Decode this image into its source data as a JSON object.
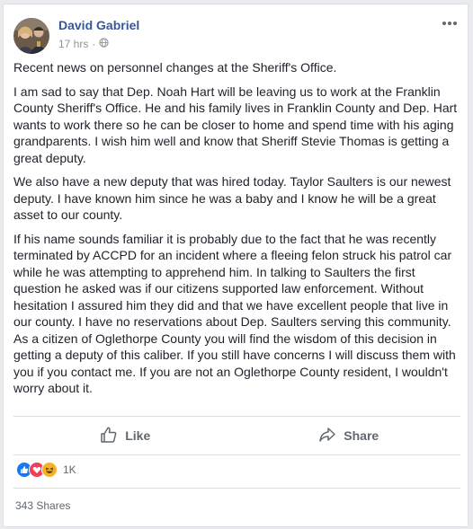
{
  "post": {
    "author": "David Gabriel",
    "time": "17 hrs",
    "separator": "·",
    "paragraphs": [
      "Recent news on personnel changes at the Sheriff's Office.",
      "I am sad to say that Dep. Noah Hart will be leaving us to work at the Franklin County Sheriff's Office. He and his family lives in Franklin County and Dep. Hart wants to work there so he can be closer to home and spend time with his aging grandparents. I wish him well and know that Sheriff Stevie Thomas is getting a great deputy.",
      "We also have a new deputy that was hired today. Taylor Saulters is our newest deputy. I have known him since he was a baby and I know he will be a great asset to our county.",
      "If his name sounds familiar it is probably due to the fact that he was recently terminated by ACCPD for an incident where a fleeing felon struck his patrol car while he was attempting to apprehend him. In talking to Saulters the first question he asked was if our citizens supported law enforcement. Without hesitation I assured him they did and that we have excellent people that live in our county. I have no reservations about Dep. Saulters serving this community. As a citizen of Oglethorpe County you will find the wisdom of this decision in getting a deputy of this caliber. If you still have concerns I will discuss them with you if you contact me. If you are not an Oglethorpe County resident, I wouldn't worry about it."
    ]
  },
  "actions": {
    "like_label": "Like",
    "share_label": "Share"
  },
  "stats": {
    "reaction_count": "1K",
    "shares": "343 Shares"
  },
  "icons": {
    "privacy": "globe-icon",
    "like": "thumbs-up-icon",
    "share": "share-arrow-icon",
    "reactions": [
      "like-reaction-icon",
      "love-reaction-icon",
      "haha-reaction-icon"
    ]
  },
  "colors": {
    "author_link": "#365899",
    "like_blue": "#1877f2",
    "love_red": "#f33e58",
    "haha_yellow": "#f7b125"
  }
}
